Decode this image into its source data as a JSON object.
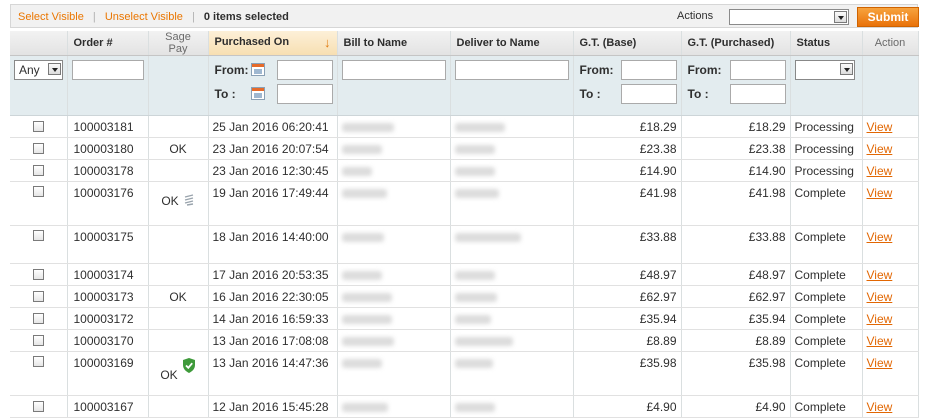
{
  "massaction": {
    "select_visible": "Select Visible",
    "separator": "|",
    "unselect_visible": "Unselect Visible",
    "count_text": "0 items selected",
    "actions_label": "Actions",
    "submit_label": "Submit"
  },
  "columns": [
    "Order #",
    "Sage Pay",
    "Purchased On",
    "Bill to Name",
    "Deliver to Name",
    "G.T. (Base)",
    "G.T. (Purchased)",
    "Status",
    "Action"
  ],
  "filter": {
    "any_label": "Any",
    "from_label": "From:",
    "to_label": "To :"
  },
  "rows": [
    {
      "order": "100003181",
      "sagepay": "",
      "date": "25 Jan 2016 06:20:41",
      "base": "£18.29",
      "purchased": "£18.29",
      "status": "Processing",
      "action": "View"
    },
    {
      "order": "100003180",
      "sagepay": "OK",
      "date": "23 Jan 2016 20:07:54",
      "base": "£23.38",
      "purchased": "£23.38",
      "status": "Processing",
      "action": "View"
    },
    {
      "order": "100003178",
      "sagepay": "",
      "date": "23 Jan 2016 12:30:45",
      "base": "£14.90",
      "purchased": "£14.90",
      "status": "Processing",
      "action": "View"
    },
    {
      "order": "100003176",
      "sagepay": "OK",
      "date": "19 Jan 2016 17:49:44",
      "base": "£41.98",
      "purchased": "£41.98",
      "status": "Complete",
      "action": "View"
    },
    {
      "order": "100003175",
      "sagepay": "",
      "date": "18 Jan 2016 14:40:00",
      "base": "£33.88",
      "purchased": "£33.88",
      "status": "Complete",
      "action": "View"
    },
    {
      "order": "100003174",
      "sagepay": "",
      "date": "17 Jan 2016 20:53:35",
      "base": "£48.97",
      "purchased": "£48.97",
      "status": "Complete",
      "action": "View"
    },
    {
      "order": "100003173",
      "sagepay": "OK",
      "date": "16 Jan 2016 22:30:05",
      "base": "£62.97",
      "purchased": "£62.97",
      "status": "Complete",
      "action": "View"
    },
    {
      "order": "100003172",
      "sagepay": "",
      "date": "14 Jan 2016 16:59:33",
      "base": "£35.94",
      "purchased": "£35.94",
      "status": "Complete",
      "action": "View"
    },
    {
      "order": "100003170",
      "sagepay": "",
      "date": "13 Jan 2016 17:08:08",
      "base": "£8.89",
      "purchased": "£8.89",
      "status": "Complete",
      "action": "View"
    },
    {
      "order": "100003169",
      "sagepay": "OK",
      "date": "13 Jan 2016 14:47:36",
      "base": "£35.98",
      "purchased": "£35.98",
      "status": "Complete",
      "action": "View"
    },
    {
      "order": "100003167",
      "sagepay": "",
      "date": "12 Jan 2016 15:45:28",
      "base": "£4.90",
      "purchased": "£4.90",
      "status": "Complete",
      "action": "View"
    }
  ],
  "colors": {
    "accent": "#ea7601",
    "submit": "#f08a1e",
    "filter_bg": "#e3ecef",
    "shield": "#3e9a3a"
  }
}
